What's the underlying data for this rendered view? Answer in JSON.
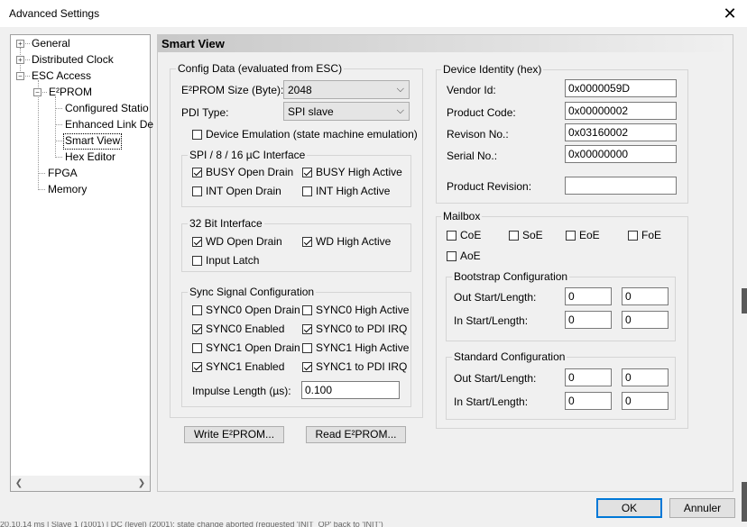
{
  "window": {
    "title": "Advanced Settings"
  },
  "tree": {
    "items": [
      {
        "label": "General"
      },
      {
        "label": "Distributed Clock"
      },
      {
        "label": "ESC Access"
      },
      {
        "label": "E²PROM"
      },
      {
        "label": "Configured Statio"
      },
      {
        "label": "Enhanced Link De"
      },
      {
        "label": "Smart View"
      },
      {
        "label": "Hex Editor"
      },
      {
        "label": "FPGA"
      },
      {
        "label": "Memory"
      }
    ]
  },
  "panel": {
    "title": "Smart View",
    "config": {
      "title": "Config Data (evaluated from ESC)",
      "eeprom_size_label": "E²PROM Size (Byte):",
      "eeprom_size_value": "2048",
      "pdi_type_label": "PDI Type:",
      "pdi_type_value": "SPI slave",
      "device_emulation": {
        "label": "Device Emulation (state machine emulation)",
        "checked": false
      },
      "spi": {
        "title": "SPI / 8 / 16 µC Interface",
        "busy_open_drain": {
          "label": "BUSY Open Drain",
          "checked": true
        },
        "busy_high_active": {
          "label": "BUSY High Active",
          "checked": true
        },
        "int_open_drain": {
          "label": "INT Open Drain",
          "checked": false
        },
        "int_high_active": {
          "label": "INT High Active",
          "checked": false
        }
      },
      "bit32": {
        "title": "32 Bit Interface",
        "wd_open_drain": {
          "label": "WD Open Drain",
          "checked": true
        },
        "wd_high_active": {
          "label": "WD High Active",
          "checked": true
        },
        "input_latch": {
          "label": "Input Latch",
          "checked": false
        }
      },
      "sync": {
        "title": "Sync Signal Configuration",
        "sync0_open_drain": {
          "label": "SYNC0 Open Drain",
          "checked": false
        },
        "sync0_high_active": {
          "label": "SYNC0 High Active",
          "checked": false
        },
        "sync0_enabled": {
          "label": "SYNC0 Enabled",
          "checked": true
        },
        "sync0_pdi_irq": {
          "label": "SYNC0 to PDI IRQ",
          "checked": true
        },
        "sync1_open_drain": {
          "label": "SYNC1 Open Drain",
          "checked": false
        },
        "sync1_high_active": {
          "label": "SYNC1 High Active",
          "checked": false
        },
        "sync1_enabled": {
          "label": "SYNC1 Enabled",
          "checked": true
        },
        "sync1_pdi_irq": {
          "label": "SYNC1 to PDI IRQ",
          "checked": true
        },
        "impulse_label": "Impulse Length (µs):",
        "impulse_value": "0.100"
      }
    },
    "write_button": "Write E²PROM...",
    "read_button": "Read E²PROM...",
    "identity": {
      "title": "Device Identity (hex)",
      "vendor_label": "Vendor Id:",
      "vendor_value": "0x0000059D",
      "product_code_label": "Product Code:",
      "product_code_value": "0x00000002",
      "revision_label": "Revison No.:",
      "revision_value": "0x03160002",
      "serial_label": "Serial No.:",
      "serial_value": "0x00000000",
      "product_revision_label": "Product Revision:",
      "product_revision_value": ""
    },
    "mailbox": {
      "title": "Mailbox",
      "coe": {
        "label": "CoE",
        "checked": false
      },
      "soe": {
        "label": "SoE",
        "checked": false
      },
      "eoe": {
        "label": "EoE",
        "checked": false
      },
      "foe": {
        "label": "FoE",
        "checked": false
      },
      "aoe": {
        "label": "AoE",
        "checked": false
      },
      "bootstrap": {
        "title": "Bootstrap Configuration",
        "out_label": "Out Start/Length:",
        "out_start": "0",
        "out_length": "0",
        "in_label": "In Start/Length:",
        "in_start": "0",
        "in_length": "0"
      },
      "standard": {
        "title": "Standard Configuration",
        "out_label": "Out Start/Length:",
        "out_start": "0",
        "out_length": "0",
        "in_label": "In Start/Length:",
        "in_start": "0",
        "in_length": "0"
      }
    }
  },
  "footer": {
    "ok": "OK",
    "cancel": "Annuler"
  },
  "background_text": "20.10.14 ms | Slave 1 (1001) | DC (level) (2001): state change aborted (requested 'INIT_OP' back to 'INIT')"
}
